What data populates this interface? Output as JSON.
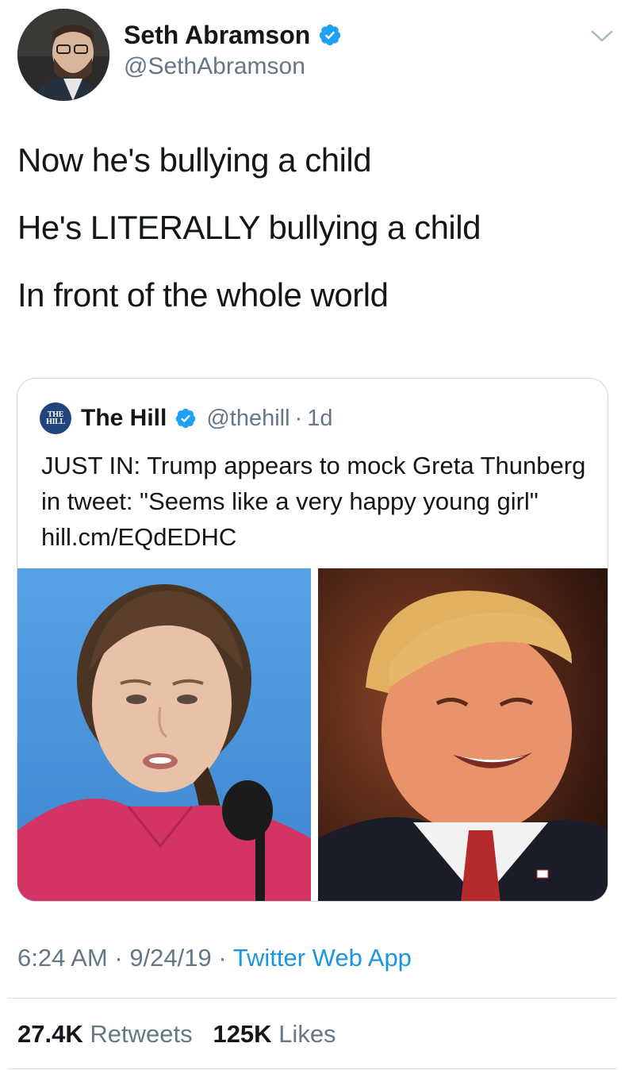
{
  "tweet": {
    "author": {
      "name": "Seth Abramson",
      "handle": "@SethAbramson",
      "verified": true
    },
    "text_lines": [
      "Now he's bullying a child",
      "He's LITERALLY bullying a child",
      "In front of the whole world"
    ],
    "quoted": {
      "logo_text_top": "THE",
      "logo_text_bottom": "HILL",
      "name": "The Hill",
      "handle": "@thehill",
      "separator": "·",
      "time": "1d",
      "text": "JUST IN: Trump appears to mock Greta Thunberg in tweet: \"Seems like a very happy young girl\" hill.cm/EQdEDHC"
    },
    "meta": {
      "time": "6:24 AM",
      "separator": "·",
      "date": "9/24/19",
      "app": "Twitter Web App"
    },
    "stats": {
      "retweets_count": "27.4K",
      "retweets_label": "Retweets",
      "likes_count": "125K",
      "likes_label": "Likes"
    }
  },
  "colors": {
    "verified_blue": "#1da1f2",
    "link_blue": "#1b95e0",
    "secondary_text": "#657786",
    "border": "#ccd6dd",
    "hill_blue": "#20457d"
  },
  "icons": {
    "verified": "verified-badge-icon",
    "menu": "chevron-down-icon"
  }
}
